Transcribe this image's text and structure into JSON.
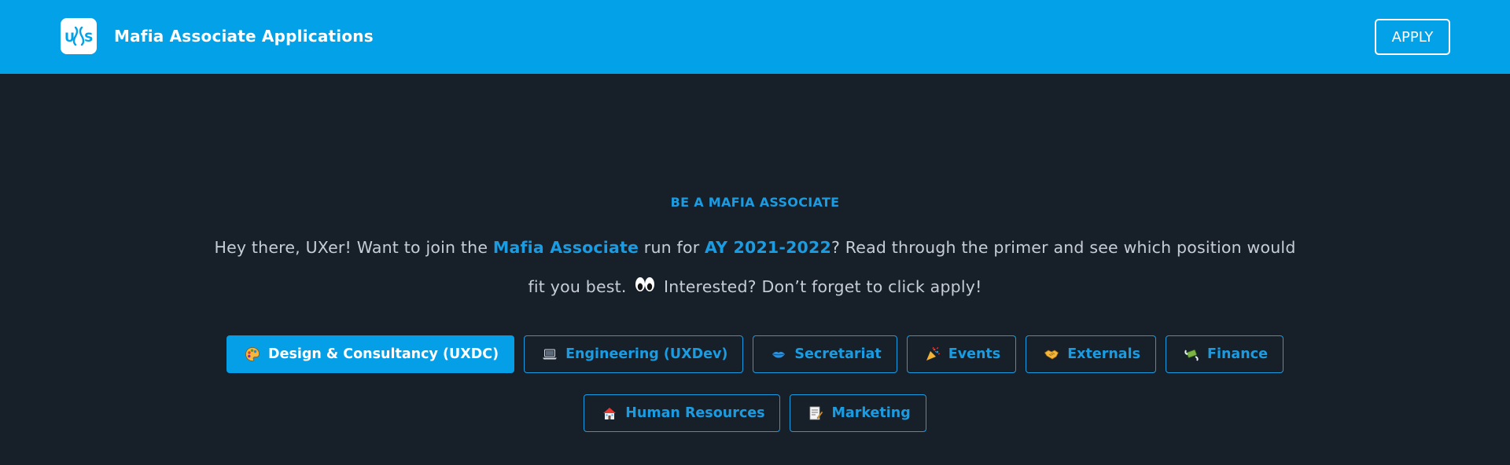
{
  "header": {
    "title": "Mafia Associate Applications",
    "apply_label": "APPLY",
    "logo_text": "UXS",
    "background": "#03a2e8"
  },
  "main": {
    "eyebrow": "BE A MAFIA ASSOCIATE",
    "intro": {
      "part1": "Hey there, UXer! Want to join the ",
      "link1": "Mafia Associate",
      "part2": " run for ",
      "link2": "AY 2021-2022",
      "part3": "? Read through the primer and see which position would fit you best.",
      "part4": "Interested? Don’t forget to click apply!"
    },
    "tabs": [
      {
        "label": "Design & Consultancy (UXDC)",
        "icon": "palette-icon",
        "active": true
      },
      {
        "label": "Engineering (UXDev)",
        "icon": "laptop-icon",
        "active": false
      },
      {
        "label": "Secretariat",
        "icon": "lips-icon",
        "active": false
      },
      {
        "label": "Events",
        "icon": "party-popper-icon",
        "active": false
      },
      {
        "label": "Externals",
        "icon": "handshake-icon",
        "active": false
      },
      {
        "label": "Finance",
        "icon": "money-wings-icon",
        "active": false
      },
      {
        "label": "Human Resources",
        "icon": "house-icon",
        "active": false
      },
      {
        "label": "Marketing",
        "icon": "memo-icon",
        "active": false
      }
    ]
  },
  "colors": {
    "accent": "#1a9ce3",
    "background": "#171f29",
    "text": "#c7cdd6"
  }
}
